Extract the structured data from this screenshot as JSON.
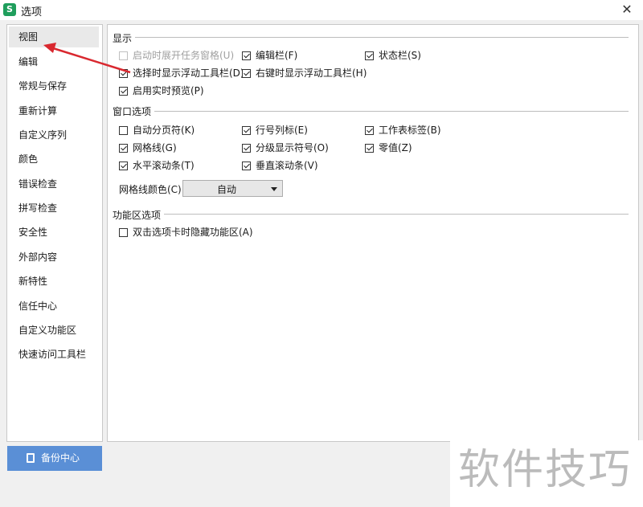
{
  "window": {
    "title": "选项",
    "app_icon_letter": "S",
    "close_glyph": "✕"
  },
  "sidebar": {
    "items": [
      {
        "label": "视图",
        "active": true
      },
      {
        "label": "编辑"
      },
      {
        "label": "常规与保存"
      },
      {
        "label": "重新计算"
      },
      {
        "label": "自定义序列"
      },
      {
        "label": "颜色"
      },
      {
        "label": "错误检查"
      },
      {
        "label": "拼写检查"
      },
      {
        "label": "安全性"
      },
      {
        "label": "外部内容"
      },
      {
        "label": "新特性"
      },
      {
        "label": "信任中心"
      },
      {
        "label": "自定义功能区"
      },
      {
        "label": "快速访问工具栏"
      }
    ]
  },
  "sections": {
    "display": {
      "title": "显示",
      "options": [
        {
          "label": "启动时展开任务窗格(U)",
          "checked": false,
          "disabled": true
        },
        {
          "label": "编辑栏(F)",
          "checked": true
        },
        {
          "label": "状态栏(S)",
          "checked": true
        },
        {
          "label": "选择时显示浮动工具栏(D)",
          "checked": true
        },
        {
          "label": "右键时显示浮动工具栏(H)",
          "checked": true
        },
        {
          "label": "启用实时预览(P)",
          "checked": true
        }
      ]
    },
    "window_options": {
      "title": "窗口选项",
      "options": [
        {
          "label": "自动分页符(K)",
          "checked": false
        },
        {
          "label": "行号列标(E)",
          "checked": true
        },
        {
          "label": "工作表标签(B)",
          "checked": true
        },
        {
          "label": "网格线(G)",
          "checked": true
        },
        {
          "label": "分级显示符号(O)",
          "checked": true
        },
        {
          "label": "零值(Z)",
          "checked": true
        },
        {
          "label": "水平滚动条(T)",
          "checked": true
        },
        {
          "label": "垂直滚动条(V)",
          "checked": true
        }
      ],
      "grid_color_label": "网格线颜色(C):",
      "grid_color_value": "自动"
    },
    "ribbon": {
      "title": "功能区选项",
      "options": [
        {
          "label": "双击选项卡时隐藏功能区(A)",
          "checked": false
        }
      ]
    }
  },
  "backup_button": {
    "label": "备份中心"
  },
  "watermark": "软件技巧",
  "colors": {
    "accent_button": "#5a8fd6",
    "annotation_arrow": "#d9282f"
  }
}
